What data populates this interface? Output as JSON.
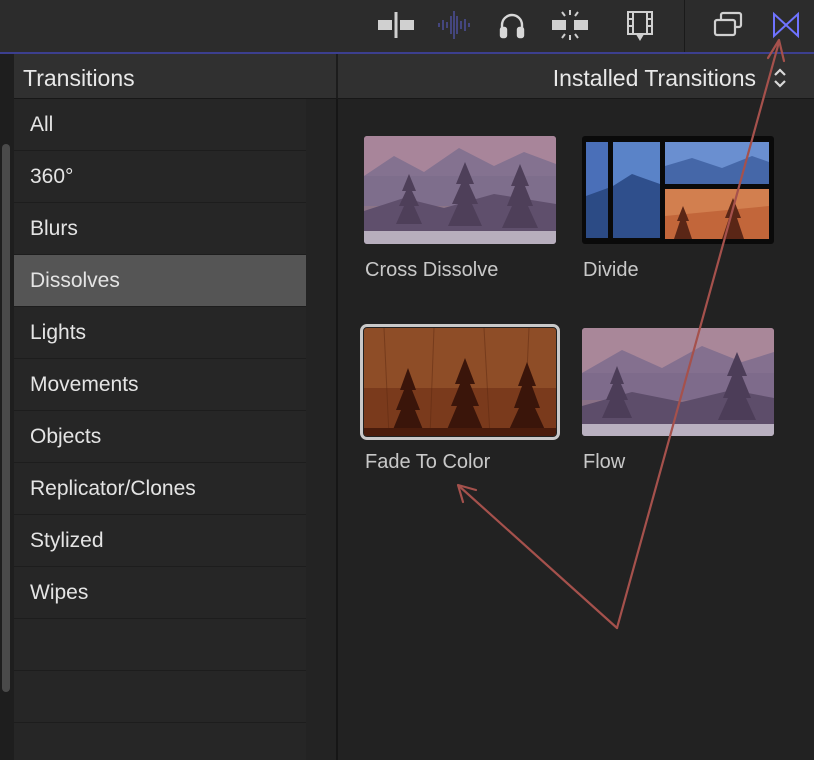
{
  "toolbar": {
    "icons": [
      "clip-skimming-icon",
      "audio-skimming-icon",
      "headphones-icon",
      "snapping-icon",
      "video-effects-icon",
      "generators-icon",
      "transitions-icon"
    ],
    "active_color": "#6f73ff"
  },
  "sidebar": {
    "title": "Transitions",
    "items": [
      {
        "label": "All"
      },
      {
        "label": "360°"
      },
      {
        "label": "Blurs"
      },
      {
        "label": "Dissolves"
      },
      {
        "label": "Lights"
      },
      {
        "label": "Movements"
      },
      {
        "label": "Objects"
      },
      {
        "label": "Replicator/Clones"
      },
      {
        "label": "Stylized"
      },
      {
        "label": "Wipes"
      }
    ],
    "selected": "Dissolves"
  },
  "browser": {
    "title": "Installed Transitions",
    "items": [
      {
        "label": "Cross Dissolve"
      },
      {
        "label": "Divide"
      },
      {
        "label": "Fade To Color",
        "selected": true
      },
      {
        "label": "Flow"
      }
    ]
  },
  "annotation": {
    "color": "#a5514c"
  }
}
